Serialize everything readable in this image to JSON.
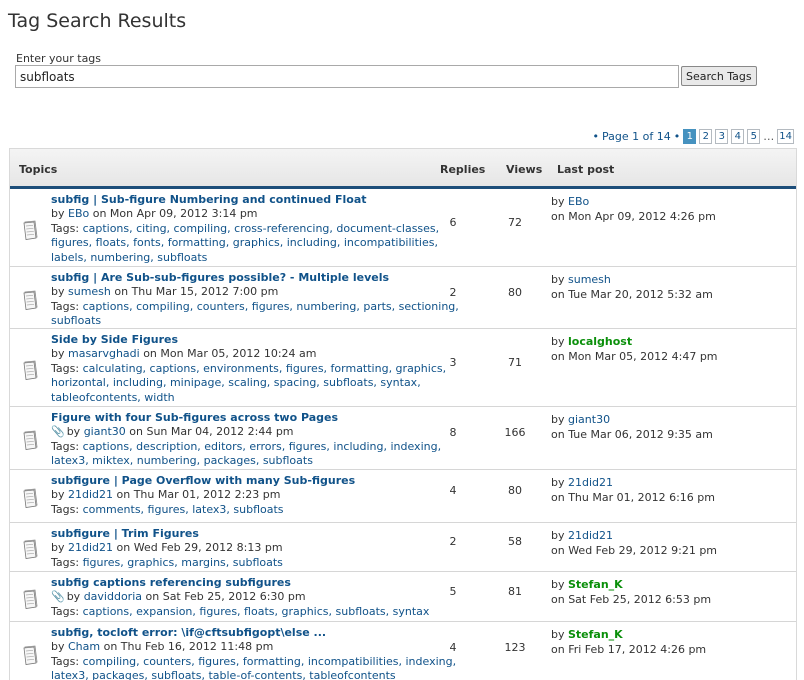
{
  "page": {
    "title": "Tag Search Results"
  },
  "search": {
    "label": "Enter your tags",
    "value": "subfloats",
    "button": "Search Tags"
  },
  "pagination": {
    "label": "Page 1 of 14",
    "bullet": "•",
    "pages": [
      "1",
      "2",
      "3",
      "4",
      "5"
    ],
    "ellipsis": "…",
    "last": "14"
  },
  "table": {
    "headers": {
      "topics": "Topics",
      "replies": "Replies",
      "views": "Views",
      "last_post": "Last post"
    },
    "rows": [
      {
        "title": "subfig | Sub-figure Numbering and continued Float",
        "by": "by",
        "author": "EBo",
        "date": " on Mon Apr 09, 2012 3:14 pm",
        "tags_prefix": "Tags:",
        "tags_lines": [
          "captions, citing, compiling, cross-referencing, document-classes,",
          "figures, floats, fonts, formatting, graphics, including, incompatibilities,",
          "labels, numbering, subfloats"
        ],
        "replies": "6",
        "views": "72",
        "last_by": "by",
        "last_author": "EBo",
        "last_date": "on Mon Apr 09, 2012 4:26 pm",
        "last_green": false,
        "attach": false
      },
      {
        "title": "subfig | Are Sub-sub-figures possible? - Multiple levels",
        "by": "by",
        "author": "sumesh",
        "date": " on Thu Mar 15, 2012 7:00 pm",
        "tags_prefix": "Tags:",
        "tags_lines": [
          "captions, compiling, counters, figures, numbering, parts, sectioning,",
          "subfloats"
        ],
        "replies": "2",
        "views": "80",
        "last_by": "by",
        "last_author": "sumesh",
        "last_date": "on Tue Mar 20, 2012 5:32 am",
        "last_green": false,
        "attach": false
      },
      {
        "title": "Side by Side Figures",
        "by": "by",
        "author": "masarvghadi",
        "date": " on Mon Mar 05, 2012 10:24 am",
        "tags_prefix": "Tags:",
        "tags_lines": [
          "calculating, captions, environments, figures, formatting, graphics,",
          "horizontal, including, minipage, scaling, spacing, subfloats, syntax,",
          "tableofcontents, width"
        ],
        "replies": "3",
        "views": "71",
        "last_by": "by",
        "last_author": "localghost",
        "last_date": "on Mon Mar 05, 2012 4:47 pm",
        "last_green": true,
        "attach": false
      },
      {
        "title": "Figure with four Sub-figures across two Pages",
        "by": "by",
        "author": "giant30",
        "date": " on Sun Mar 04, 2012 2:44 pm",
        "tags_prefix": "Tags:",
        "tags_lines": [
          "captions, description, editors, errors, figures, including, indexing,",
          "latex3, miktex, numbering, packages, subfloats"
        ],
        "replies": "8",
        "views": "166",
        "last_by": "by",
        "last_author": "giant30",
        "last_date": "on Tue Mar 06, 2012 9:35 am",
        "last_green": false,
        "attach": true
      },
      {
        "title": "subfigure | Page Overflow with many Sub-figures",
        "by": "by",
        "author": "21did21",
        "date": " on Thu Mar 01, 2012 2:23 pm",
        "tags_prefix": "Tags:",
        "tags_lines": [
          "comments, figures, latex3, subfloats"
        ],
        "replies": "4",
        "views": "80",
        "last_by": "by",
        "last_author": "21did21",
        "last_date": "on Thu Mar 01, 2012 6:16 pm",
        "last_green": false,
        "attach": false
      },
      {
        "title": "subfigure | Trim Figures",
        "by": "by",
        "author": "21did21",
        "date": " on Wed Feb 29, 2012 8:13 pm",
        "tags_prefix": "Tags:",
        "tags_lines": [
          "figures, graphics, margins, subfloats"
        ],
        "replies": "2",
        "views": "58",
        "last_by": "by",
        "last_author": "21did21",
        "last_date": "on Wed Feb 29, 2012 9:21 pm",
        "last_green": false,
        "attach": false
      },
      {
        "title": "subfig captions referencing subfigures",
        "by": "by",
        "author": "daviddoria",
        "date": " on Sat Feb 25, 2012 6:30 pm",
        "tags_prefix": "Tags:",
        "tags_lines": [
          "captions, expansion, figures, floats, graphics, subfloats, syntax"
        ],
        "replies": "5",
        "views": "81",
        "last_by": "by",
        "last_author": "Stefan_K",
        "last_date": "on Sat Feb 25, 2012 6:53 pm",
        "last_green": true,
        "attach": true
      },
      {
        "title": "subfig, tocloft error: \\if@cftsubfigopt\\else ...",
        "by": "by",
        "author": "Cham",
        "date": " on Thu Feb 16, 2012 11:48 pm",
        "tags_prefix": "Tags:",
        "tags_lines": [
          "compiling, counters, figures, formatting, incompatibilities, indexing,",
          "latex3, packages, subfloats, table-of-contents, tableofcontents"
        ],
        "replies": "4",
        "views": "123",
        "last_by": "by",
        "last_author": "Stefan_K",
        "last_date": "on Fri Feb 17, 2012 4:26 pm",
        "last_green": true,
        "attach": false
      }
    ]
  }
}
